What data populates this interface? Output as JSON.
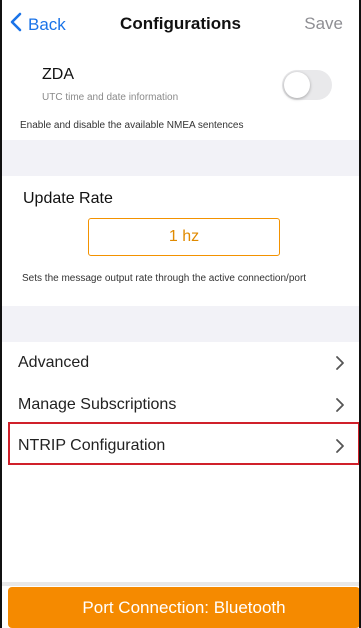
{
  "nav": {
    "back_label": "Back",
    "title": "Configurations",
    "save_label": "Save"
  },
  "zda": {
    "title": "ZDA",
    "subtitle": "UTC time and date information",
    "enabled": false
  },
  "nmea_description": "Enable and disable the available NMEA sentences",
  "update_rate": {
    "title": "Update Rate",
    "value": "1 hz",
    "description": "Sets the message output rate through the active connection/port"
  },
  "list": {
    "items": [
      {
        "label": "Advanced"
      },
      {
        "label": "Manage Subscriptions"
      },
      {
        "label": "NTRIP Configuration"
      }
    ]
  },
  "port_button": {
    "label": "Port Connection: Bluetooth"
  },
  "colors": {
    "accent_blue": "#1a73e8",
    "orange": "#f58a00",
    "highlight_red": "#d0202a"
  }
}
